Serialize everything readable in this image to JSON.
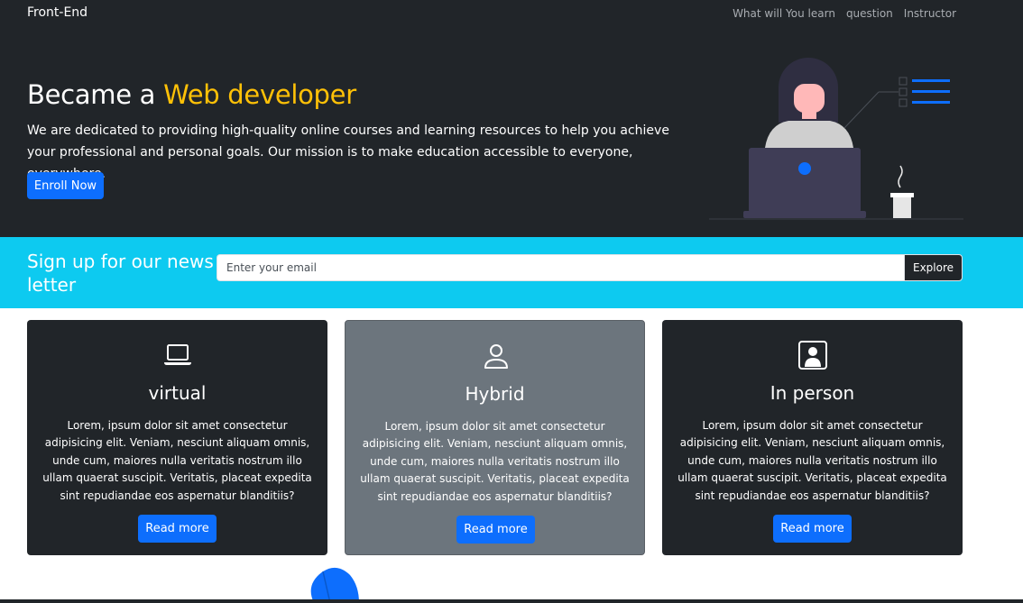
{
  "navbar": {
    "brand": "Front-End",
    "links": [
      "What will You learn",
      "question",
      "Instructor"
    ]
  },
  "hero": {
    "title_plain": "Became a ",
    "title_accent": "Web developer",
    "description": "We are dedicated to providing high-quality online courses and learning resources to help you achieve your professional and personal goals. Our mission is to make education accessible to everyone, everywhere.",
    "enroll_label": "Enroll Now",
    "illustration": "person-with-laptop-illustration"
  },
  "newsletter": {
    "title": "Sign up for our news letter",
    "placeholder": "Enter your email",
    "value": "",
    "button_label": "Explore"
  },
  "cards": [
    {
      "icon": "laptop-icon",
      "title": "virtual",
      "text": "Lorem, ipsum dolor sit amet consectetur adipisicing elit. Veniam, nesciunt aliquam omnis, unde cum, maiores nulla veritatis nostrum illo ullam quaerat suscipit. Veritatis, placeat expedita sint repudiandae eos aspernatur blanditiis?",
      "button_label": "Read more",
      "theme": "dark"
    },
    {
      "icon": "person-icon",
      "title": "Hybrid",
      "text": "Lorem, ipsum dolor sit amet consectetur adipisicing elit. Veniam, nesciunt aliquam omnis, unde cum, maiores nulla veritatis nostrum illo ullam quaerat suscipit. Veritatis, placeat expedita sint repudiandae eos aspernatur blanditiis?",
      "button_label": "Read more",
      "theme": "gray"
    },
    {
      "icon": "person-square-icon",
      "title": "In person",
      "text": "Lorem, ipsum dolor sit amet consectetur adipisicing elit. Veniam, nesciunt aliquam omnis, unde cum, maiores nulla veritatis nostrum illo ullam quaerat suscipit. Veritatis, placeat expedita sint repudiandae eos aspernatur blanditiis?",
      "button_label": "Read more",
      "theme": "dark"
    }
  ],
  "colors": {
    "dark": "#212529",
    "accent": "#ffc107",
    "primary": "#0d6efd",
    "info": "#0dcaf0",
    "gray": "#6c757d"
  }
}
